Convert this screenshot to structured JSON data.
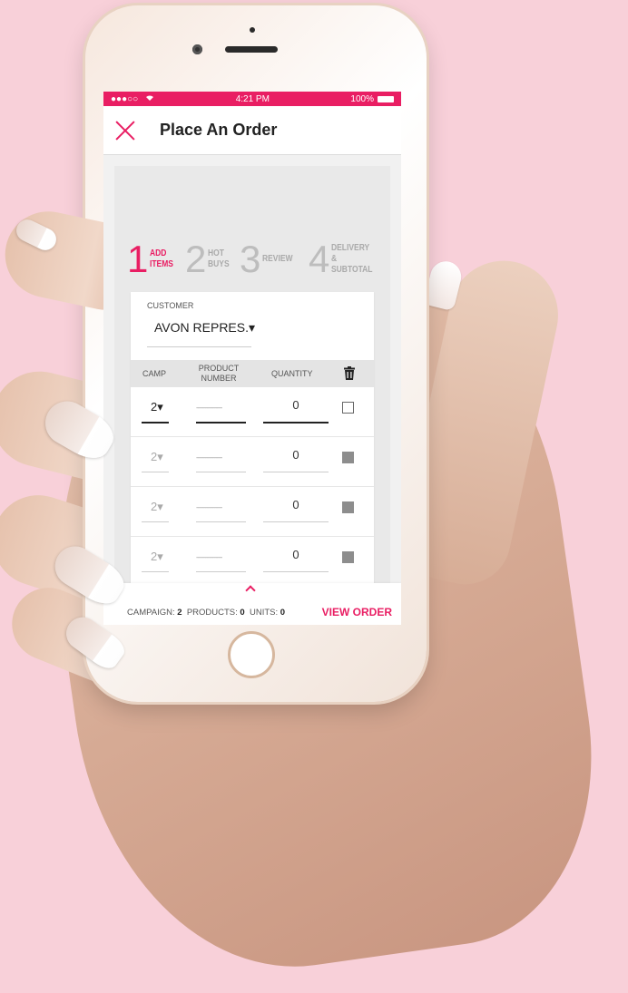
{
  "status_bar": {
    "carrier_dots": "●●●○○",
    "time": "4:21 PM",
    "battery": "100%"
  },
  "header": {
    "title": "Place An Order"
  },
  "steps": [
    {
      "number": "1",
      "label_1": "ADD",
      "label_2": "ITEMS",
      "label_3": "",
      "active": true
    },
    {
      "number": "2",
      "label_1": "HOT",
      "label_2": "BUYS",
      "label_3": "",
      "active": false
    },
    {
      "number": "3",
      "label_1": "REVIEW",
      "label_2": "",
      "label_3": "",
      "active": false
    },
    {
      "number": "4",
      "label_1": "DELIVERY",
      "label_2": "&",
      "label_3": "SUBTOTAL",
      "active": false
    }
  ],
  "customer": {
    "label": "CUSTOMER",
    "value": "AVON REPRES.▾"
  },
  "table": {
    "headers": {
      "camp": "CAMP",
      "product": "PRODUCT NUMBER",
      "quantity": "QUANTITY"
    },
    "rows": [
      {
        "camp": "2▾",
        "product": "-----------------",
        "quantity": "0",
        "active": true
      },
      {
        "camp": "2▾",
        "product": "-----------------",
        "quantity": "0",
        "active": false
      },
      {
        "camp": "2▾",
        "product": "-----------------",
        "quantity": "0",
        "active": false
      },
      {
        "camp": "2▾",
        "product": "-----------------",
        "quantity": "0",
        "active": false
      }
    ]
  },
  "footer": {
    "campaign_label": "CAMPAIGN:",
    "campaign_value": "2",
    "products_label": "PRODUCTS:",
    "products_value": "0",
    "units_label": "UNITS:",
    "units_value": "0",
    "view_order": "VIEW ORDER"
  },
  "colors": {
    "accent": "#e91e63",
    "background": "#f8d0d9"
  }
}
